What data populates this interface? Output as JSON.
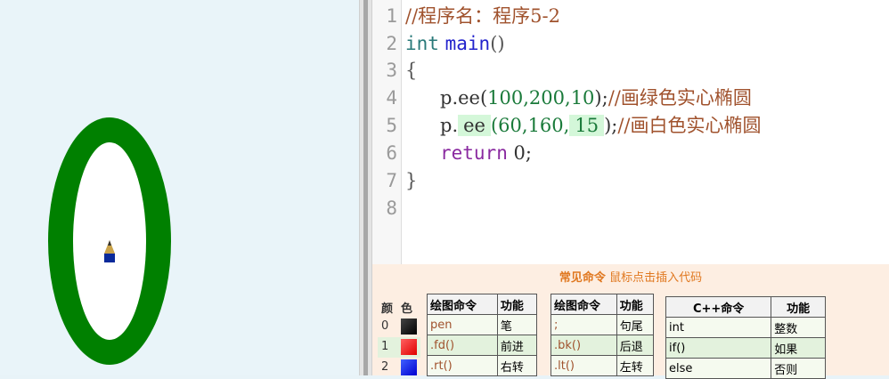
{
  "canvas": {
    "shape_colors": {
      "outer": "#008000",
      "inner": "#ffffff"
    }
  },
  "editor": {
    "lines": [
      {
        "num": "1",
        "text": "//程序名：程序5-2"
      },
      {
        "num": "2",
        "kw": "int",
        "fn": "main",
        "rest": "()"
      },
      {
        "num": "3",
        "text": "{"
      },
      {
        "num": "4",
        "prefix": "p.ee(",
        "args": "100,200,10",
        "suffix": ");",
        "comment": "//画绿色实心椭圆"
      },
      {
        "num": "5",
        "prefix": "p.",
        "hl1": "ee",
        "mid": "(60,160,",
        "hl2": "15",
        "suffix": ");",
        "comment": "//画白色实心椭圆"
      },
      {
        "num": "6",
        "kw": "return",
        "rest": "0;"
      },
      {
        "num": "7",
        "text": "}"
      },
      {
        "num": "8",
        "text": ""
      }
    ]
  },
  "panel": {
    "title": "常见命令",
    "subtitle": "鼠标点击插入代码",
    "colors_header": [
      "颜",
      "色"
    ],
    "colors": [
      {
        "idx": "0",
        "color": "#000000"
      },
      {
        "idx": "1",
        "color": "#ff0000"
      },
      {
        "idx": "2",
        "color": "#0000ff"
      }
    ],
    "table1": {
      "headers": [
        "绘图命令",
        "功能"
      ],
      "rows": [
        [
          "pen",
          "笔"
        ],
        [
          ".fd()",
          "前进"
        ],
        [
          ".rt()",
          "右转"
        ]
      ]
    },
    "table2": {
      "headers": [
        "绘图命令",
        "功能"
      ],
      "rows": [
        [
          ";",
          "句尾"
        ],
        [
          ".bk()",
          "后退"
        ],
        [
          ".lt()",
          "左转"
        ]
      ]
    },
    "table3": {
      "headers": [
        "C++命令",
        "功能"
      ],
      "rows": [
        [
          "int",
          "整数"
        ],
        [
          "if()",
          "如果"
        ],
        [
          "else",
          "否则"
        ]
      ]
    }
  }
}
